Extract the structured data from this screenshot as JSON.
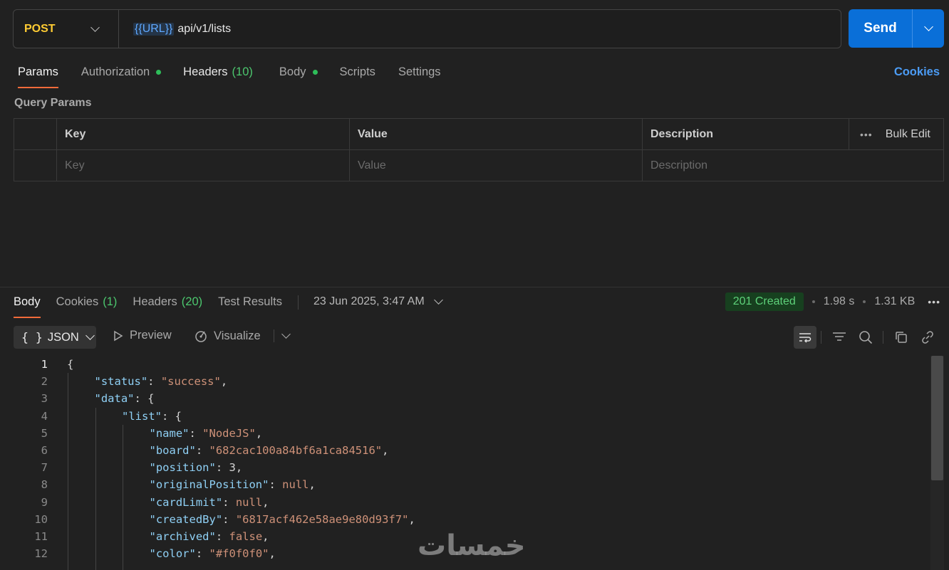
{
  "request": {
    "method": "POST",
    "url_variable": "{{URL}}",
    "url_path": "api/v1/lists",
    "send_label": "Send",
    "tabs": [
      {
        "label": "Params",
        "active": true
      },
      {
        "label": "Authorization",
        "dot": true
      },
      {
        "label": "Headers",
        "count": "(10)"
      },
      {
        "label": "Body",
        "dot": true
      },
      {
        "label": "Scripts"
      },
      {
        "label": "Settings"
      }
    ],
    "cookies_link": "Cookies",
    "query_params_title": "Query Params",
    "table": {
      "headers": [
        "Key",
        "Value",
        "Description"
      ],
      "bulk_edit": "Bulk Edit",
      "placeholders": [
        "Key",
        "Value",
        "Description"
      ]
    }
  },
  "response": {
    "tabs": [
      {
        "label": "Body",
        "active": true
      },
      {
        "label": "Cookies",
        "count": "(1)"
      },
      {
        "label": "Headers",
        "count": "(20)"
      },
      {
        "label": "Test Results"
      }
    ],
    "timestamp": "23 Jun 2025, 3:47 AM",
    "status": "201 Created",
    "time": "1.98 s",
    "size": "1.31 KB",
    "format": "JSON",
    "format_icon": "{ }",
    "preview_label": "Preview",
    "visualize_label": "Visualize",
    "code_lines": [
      {
        "n": "1",
        "indent": 0,
        "parts": [
          [
            "p",
            "{"
          ]
        ]
      },
      {
        "n": "2",
        "indent": 1,
        "parts": [
          [
            "k",
            "\"status\""
          ],
          [
            "p",
            ": "
          ],
          [
            "s",
            "\"success\""
          ],
          [
            "p",
            ","
          ]
        ]
      },
      {
        "n": "3",
        "indent": 1,
        "parts": [
          [
            "k",
            "\"data\""
          ],
          [
            "p",
            ": {"
          ]
        ]
      },
      {
        "n": "4",
        "indent": 2,
        "parts": [
          [
            "k",
            "\"list\""
          ],
          [
            "p",
            ": {"
          ]
        ]
      },
      {
        "n": "5",
        "indent": 3,
        "parts": [
          [
            "k",
            "\"name\""
          ],
          [
            "p",
            ": "
          ],
          [
            "s",
            "\"NodeJS\""
          ],
          [
            "p",
            ","
          ]
        ]
      },
      {
        "n": "6",
        "indent": 3,
        "parts": [
          [
            "k",
            "\"board\""
          ],
          [
            "p",
            ": "
          ],
          [
            "s",
            "\"682cac100a84bf6a1ca84516\""
          ],
          [
            "p",
            ","
          ]
        ]
      },
      {
        "n": "7",
        "indent": 3,
        "parts": [
          [
            "k",
            "\"position\""
          ],
          [
            "p",
            ": 3,"
          ]
        ]
      },
      {
        "n": "8",
        "indent": 3,
        "parts": [
          [
            "k",
            "\"originalPosition\""
          ],
          [
            "p",
            ": "
          ],
          [
            "s",
            "null"
          ],
          [
            "p",
            ","
          ]
        ]
      },
      {
        "n": "9",
        "indent": 3,
        "parts": [
          [
            "k",
            "\"cardLimit\""
          ],
          [
            "p",
            ": "
          ],
          [
            "s",
            "null"
          ],
          [
            "p",
            ","
          ]
        ]
      },
      {
        "n": "10",
        "indent": 3,
        "parts": [
          [
            "k",
            "\"createdBy\""
          ],
          [
            "p",
            ": "
          ],
          [
            "s",
            "\"6817acf462e58ae9e80d93f7\""
          ],
          [
            "p",
            ","
          ]
        ]
      },
      {
        "n": "11",
        "indent": 3,
        "parts": [
          [
            "k",
            "\"archived\""
          ],
          [
            "p",
            ": "
          ],
          [
            "s",
            "false"
          ],
          [
            "p",
            ","
          ]
        ]
      },
      {
        "n": "12",
        "indent": 3,
        "parts": [
          [
            "k",
            "\"color\""
          ],
          [
            "p",
            ": "
          ],
          [
            "s",
            "\"#f0f0f0\""
          ],
          [
            "p",
            ","
          ]
        ]
      }
    ]
  },
  "watermark": "خمسات",
  "colors": {
    "accent": "#f26b3a",
    "send": "#0a6fd8",
    "method": "#ffcc33",
    "success": "#5ed17a"
  }
}
